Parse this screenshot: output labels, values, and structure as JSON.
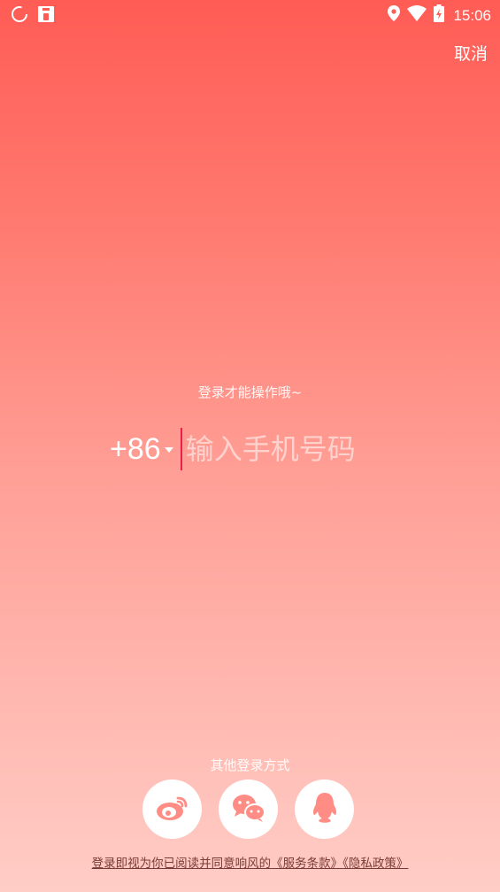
{
  "status_bar": {
    "time": "15:06",
    "icons": [
      "loading-ring-icon",
      "sim-card-icon",
      "location-pin-icon",
      "wifi-icon",
      "battery-charging-icon"
    ]
  },
  "header": {
    "cancel_label": "取消"
  },
  "login": {
    "prompt": "登录才能操作哦~",
    "country_code": "+86",
    "phone_placeholder": "输入手机号码",
    "phone_value": ""
  },
  "other_login": {
    "title": "其他登录方式",
    "providers": [
      "weibo-icon",
      "wechat-icon",
      "qq-icon"
    ]
  },
  "agreement": {
    "prefix": "登录即视为你已阅读并同意响风的",
    "terms": "《服务条款》",
    "privacy": "《隐私政策》"
  },
  "colors": {
    "gradient_top": "#ff5c55",
    "gradient_bottom": "#ffcdc6",
    "cursor": "#e8204a",
    "icon_fg": "#ff8d85"
  }
}
